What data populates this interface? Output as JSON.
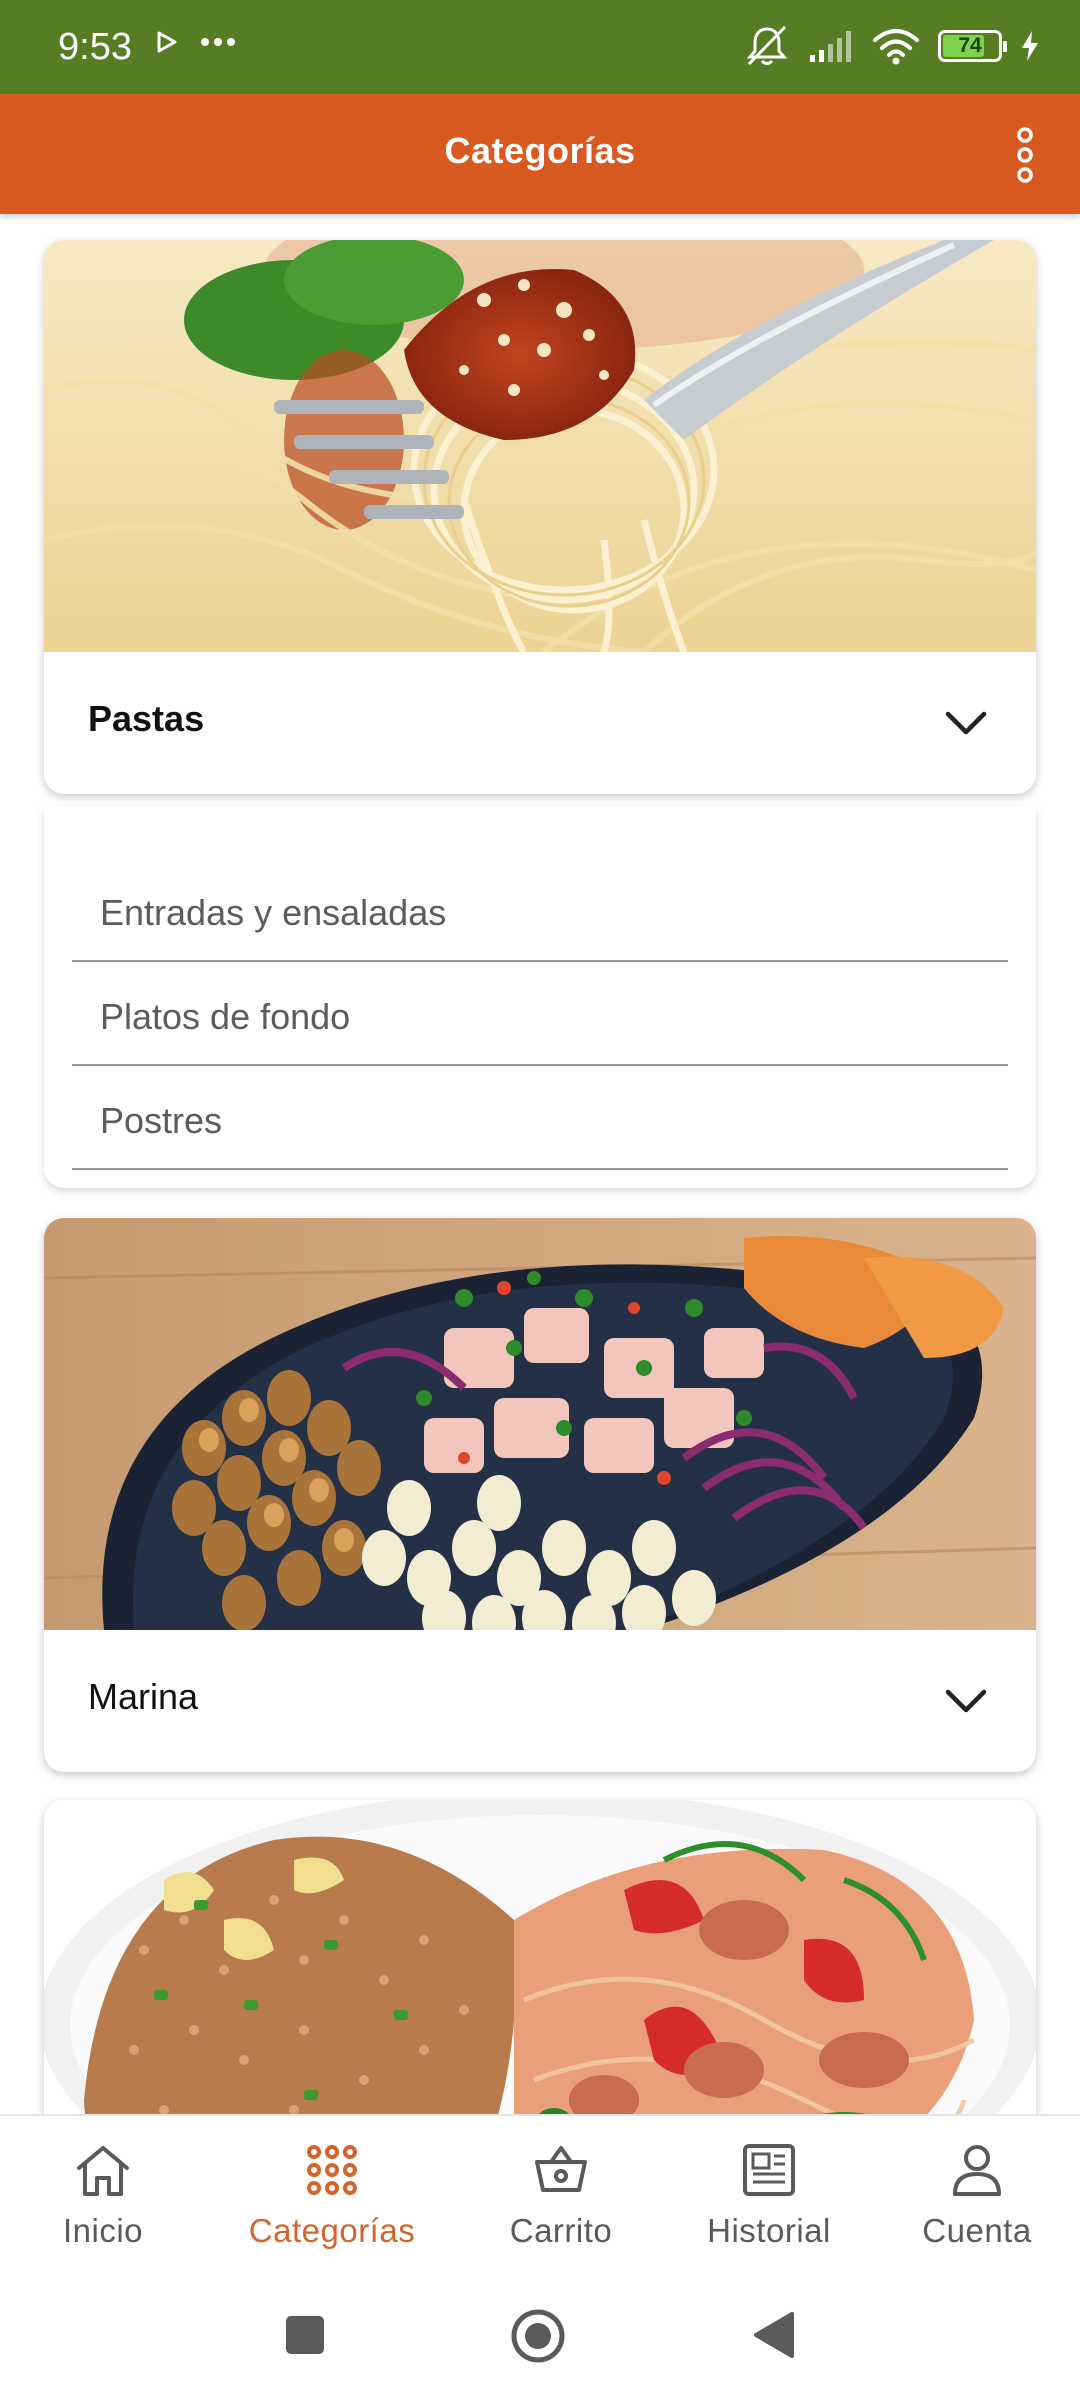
{
  "status_bar": {
    "time": "9:53",
    "battery_level": "74"
  },
  "app_bar": {
    "title": "Categorías"
  },
  "categories": [
    {
      "name": "Pastas",
      "expanded": true,
      "subcategories": [
        "Entradas y ensaladas",
        "Platos de fondo",
        "Postres"
      ]
    },
    {
      "name": "Marina",
      "expanded": false
    },
    {
      "name": "",
      "expanded": false
    }
  ],
  "bottom_nav": {
    "items": [
      {
        "label": "Inicio",
        "icon": "home-icon",
        "active": false
      },
      {
        "label": "Categorías",
        "icon": "grid-dots-icon",
        "active": true
      },
      {
        "label": "Carrito",
        "icon": "basket-icon",
        "active": false
      },
      {
        "label": "Historial",
        "icon": "newspaper-icon",
        "active": false
      },
      {
        "label": "Cuenta",
        "icon": "person-icon",
        "active": false
      }
    ]
  },
  "colors": {
    "status_bar": "#567d24",
    "app_bar": "#d95a21",
    "active_nav": "#d2642c",
    "inactive_nav": "#5a5a5a"
  }
}
